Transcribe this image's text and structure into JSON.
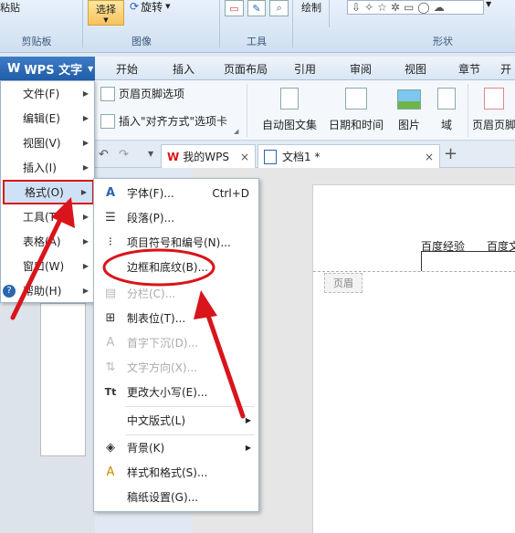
{
  "ribbon_groups": {
    "clipboard": {
      "label": "剪贴板",
      "paste_label": "粘贴"
    },
    "image": {
      "label": "图像",
      "select_label": "选择",
      "rotate_label": "旋转"
    },
    "tools": {
      "label": "工具"
    },
    "shapes": {
      "label": "形状",
      "draw_label": "绘制"
    }
  },
  "app_button": {
    "label": "WPS 文字"
  },
  "ribbon_tabs": [
    "开始",
    "插入",
    "页面布局",
    "引用",
    "审阅",
    "视图",
    "章节",
    "开"
  ],
  "ribbon_commands": {
    "header_footer_options": "页眉页脚选项",
    "insert_align_tab": "插入\"对齐方式\"选项卡",
    "auto_text": "自动图文集",
    "date_time": "日期和时间",
    "picture": "图片",
    "field": "域",
    "header_footer": "页眉页脚"
  },
  "doc_tabs": [
    {
      "label": "我的WPS"
    },
    {
      "label": "文档1 *"
    }
  ],
  "left_menu": [
    {
      "label": "文件(F)"
    },
    {
      "label": "编辑(E)"
    },
    {
      "label": "视图(V)"
    },
    {
      "label": "插入(I)"
    },
    {
      "label": "格式(O)"
    },
    {
      "label": "工具(T)"
    },
    {
      "label": "表格(A)"
    },
    {
      "label": "窗口(W)"
    },
    {
      "label": "帮助(H)"
    }
  ],
  "format_submenu": [
    {
      "label": "字体(F)...",
      "shortcut": "Ctrl+D",
      "icon": "font-icon"
    },
    {
      "label": "段落(P)...",
      "icon": "paragraph-icon"
    },
    {
      "label": "项目符号和编号(N)...",
      "icon": "bullets-icon"
    },
    {
      "label": "边框和底纹(B)...",
      "icon": ""
    },
    {
      "label": "分栏(C)...",
      "icon": "columns-icon",
      "disabled": true
    },
    {
      "label": "制表位(T)...",
      "icon": "tabstop-icon"
    },
    {
      "label": "首字下沉(D)...",
      "icon": "dropcap-icon",
      "disabled": true
    },
    {
      "label": "文字方向(X)...",
      "icon": "text-direction-icon",
      "disabled": true
    },
    {
      "label": "更改大小写(E)...",
      "icon": "change-case-icon"
    },
    {
      "label": "中文版式(L)",
      "icon": ""
    },
    {
      "label": "背景(K)",
      "icon": "bucket-icon"
    },
    {
      "label": "样式和格式(S)...",
      "icon": "styles-icon"
    },
    {
      "label": "稿纸设置(G)...",
      "icon": ""
    }
  ],
  "document": {
    "header_text_1": "百度经验",
    "header_text_2": "百度文",
    "header_tag": "页眉"
  },
  "colors": {
    "highlight_red": "#d9141b",
    "app_blue": "#215da8"
  }
}
